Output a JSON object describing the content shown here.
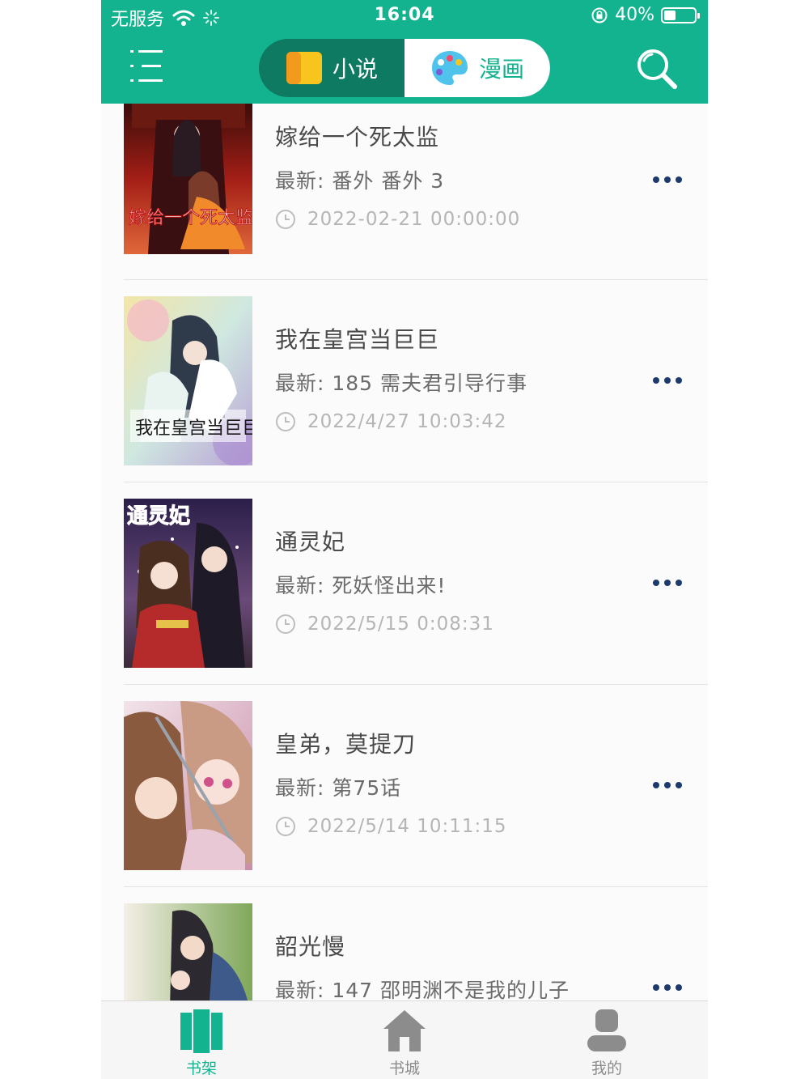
{
  "status_bar": {
    "carrier": "无服务",
    "time": "16:04",
    "battery": "40%",
    "battery_level": 0.4
  },
  "header": {
    "menu_icon": "menu-icon",
    "segments": [
      {
        "label": "小说",
        "icon": "book-icon",
        "active": false
      },
      {
        "label": "漫画",
        "icon": "palette-icon",
        "active": true
      }
    ],
    "search_icon": "search-icon"
  },
  "shelf": {
    "items": [
      {
        "title": "嫁给一个死太监",
        "latest": "最新: 番外 番外 3",
        "updated": "2022-02-21 00:00:00"
      },
      {
        "title": "我在皇宫当巨巨",
        "latest": "最新: 185 需夫君引导行事",
        "updated": "2022/4/27 10:03:42"
      },
      {
        "title": "通灵妃",
        "latest": "最新: 死妖怪出来!",
        "updated": "2022/5/15 0:08:31"
      },
      {
        "title": "皇弟，莫提刀",
        "latest": "最新: 第75话",
        "updated": "2022/5/14 10:11:15"
      },
      {
        "title": "韶光慢",
        "latest": "最新: 147 邵明渊不是我的儿子",
        "updated": ""
      }
    ]
  },
  "covers": {
    "c0": "嫁给一个死太监",
    "c1": "我在皇宫当巨巨",
    "c2": "通灵妃"
  },
  "tabbar": {
    "tabs": [
      {
        "label": "书架",
        "icon": "bookshelf-icon",
        "active": true
      },
      {
        "label": "书城",
        "icon": "home-icon",
        "active": false
      },
      {
        "label": "我的",
        "icon": "user-icon",
        "active": false
      }
    ]
  },
  "colors": {
    "brand": "#12b38e",
    "brand_dark": "#0e7a62",
    "more_dots": "#1c3a6b"
  }
}
